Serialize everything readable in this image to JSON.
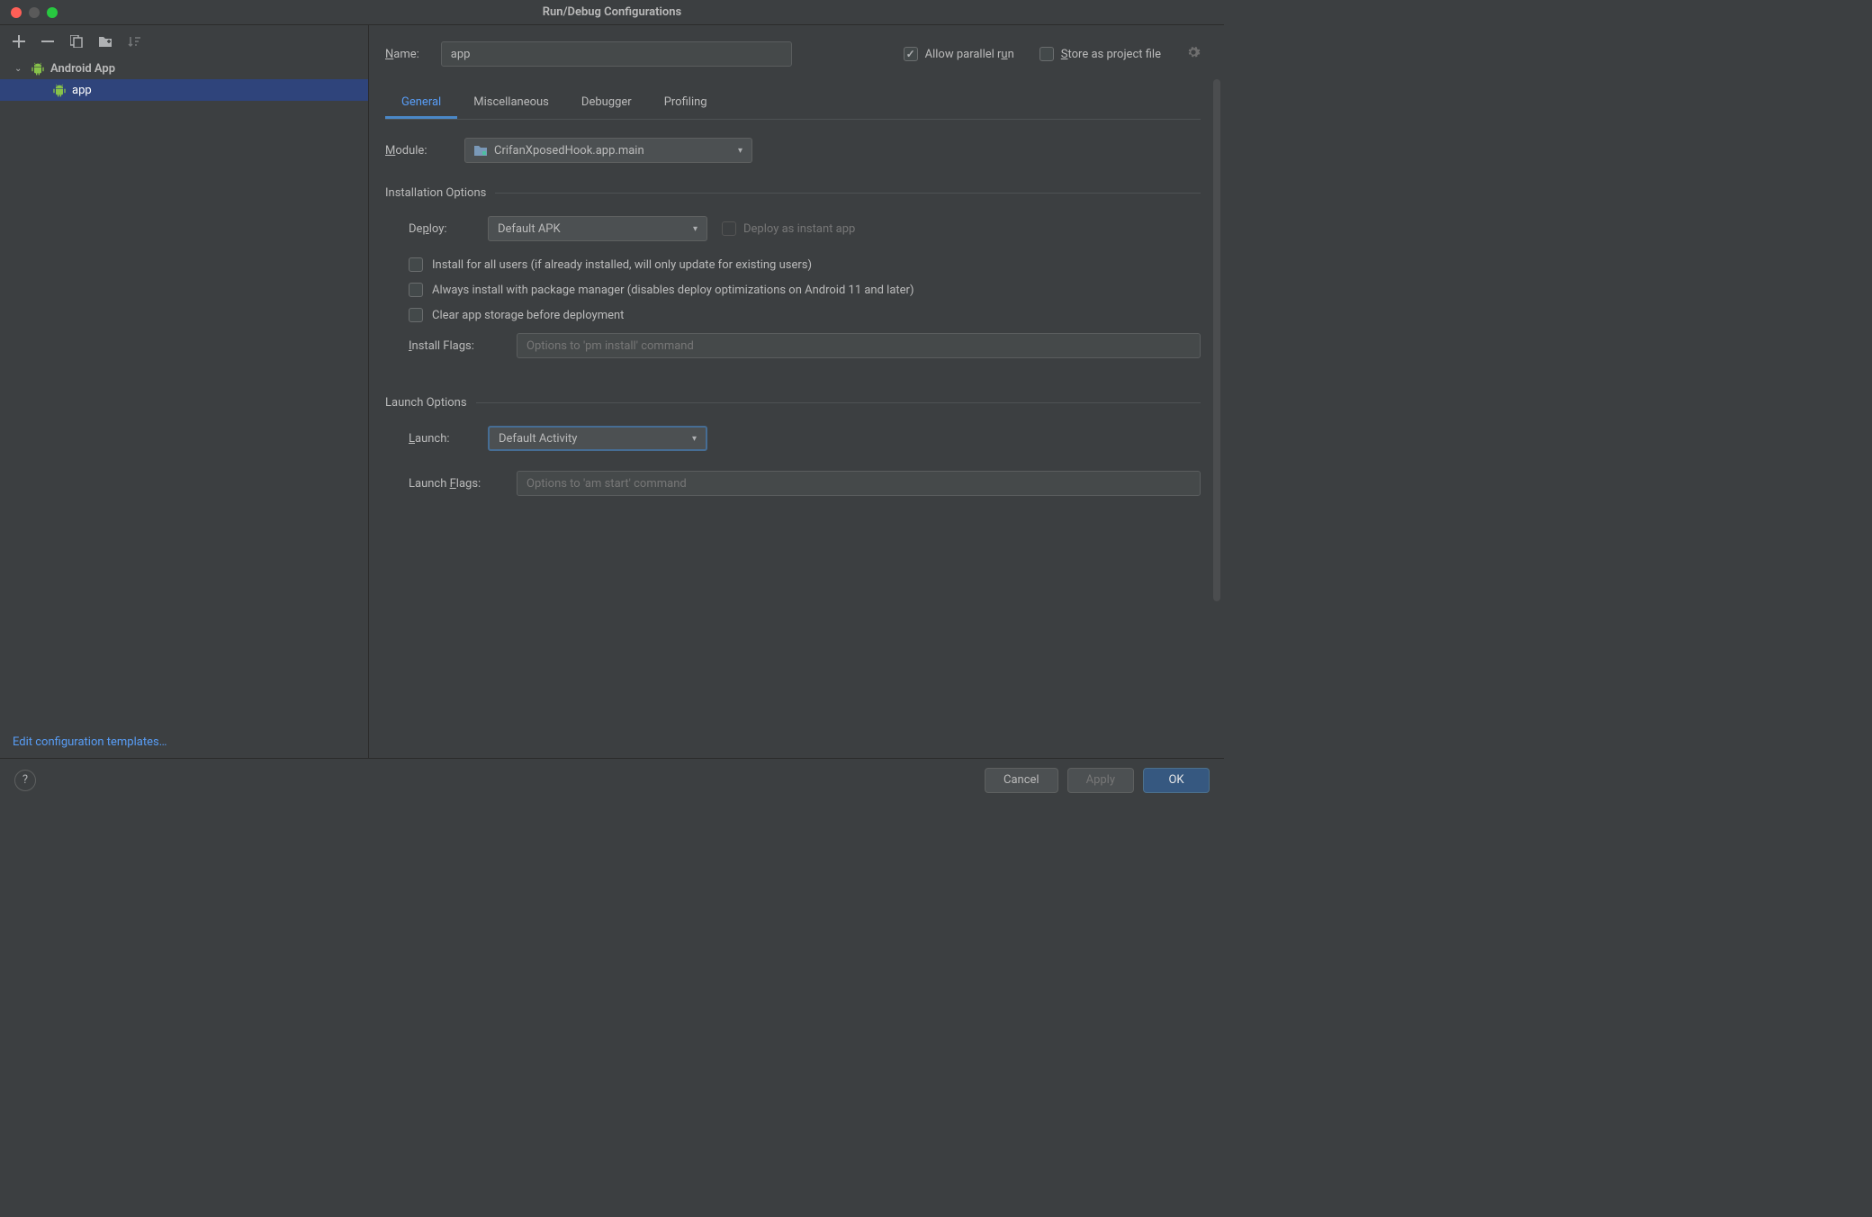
{
  "titlebar": {
    "title": "Run/Debug Configurations"
  },
  "sidebar": {
    "tree": {
      "root_label": "Android App",
      "child_label": "app"
    },
    "edit_templates": "Edit configuration templates…"
  },
  "form": {
    "name_label": "Name:",
    "name_value": "app",
    "allow_parallel": "Allow parallel run",
    "store_project_file": "Store as project file",
    "tabs": [
      "General",
      "Miscellaneous",
      "Debugger",
      "Profiling"
    ],
    "module_label": "Module:",
    "module_value": "CrifanXposedHook.app.main",
    "installation": {
      "title": "Installation Options",
      "deploy_label": "Deploy:",
      "deploy_value": "Default APK",
      "deploy_instant": "Deploy as instant app",
      "install_all_users": "Install for all users (if already installed, will only update for existing users)",
      "always_pm": "Always install with package manager (disables deploy optimizations on Android 11 and later)",
      "clear_storage": "Clear app storage before deployment",
      "install_flags_label": "Install Flags:",
      "install_flags_placeholder": "Options to 'pm install' command"
    },
    "launch": {
      "title": "Launch Options",
      "launch_label": "Launch:",
      "launch_value": "Default Activity",
      "launch_flags_label": "Launch Flags:",
      "launch_flags_placeholder": "Options to 'am start' command"
    }
  },
  "buttons": {
    "cancel": "Cancel",
    "apply": "Apply",
    "ok": "OK"
  }
}
